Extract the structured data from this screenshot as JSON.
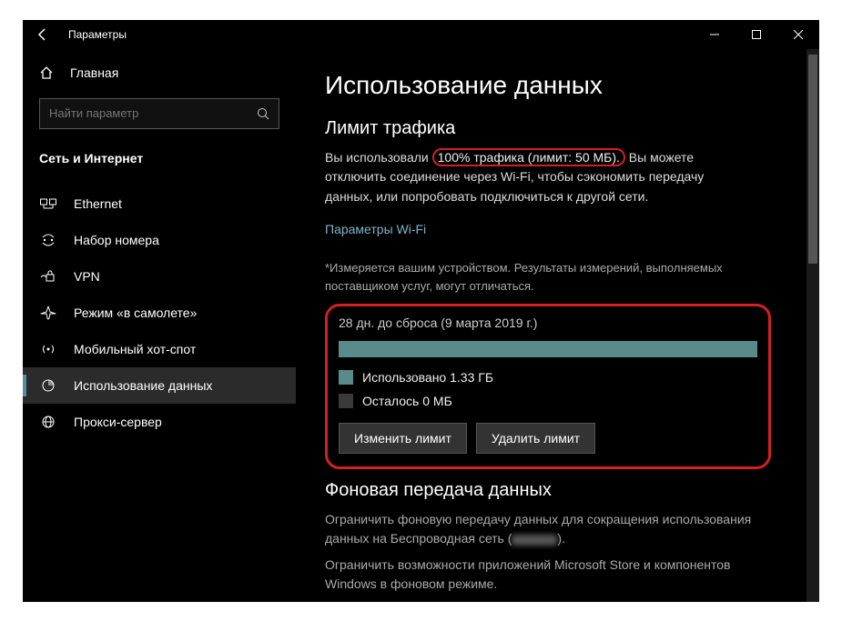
{
  "titlebar": {
    "title": "Параметры"
  },
  "sidebar": {
    "home": "Главная",
    "search_placeholder": "Найти параметр",
    "category": "Сеть и Интернет",
    "items": [
      {
        "icon": "ethernet-icon",
        "label": "Ethernet"
      },
      {
        "icon": "dialup-icon",
        "label": "Набор номера"
      },
      {
        "icon": "vpn-icon",
        "label": "VPN"
      },
      {
        "icon": "airplane-icon",
        "label": "Режим «в самолете»"
      },
      {
        "icon": "hotspot-icon",
        "label": "Мобильный хот-спот"
      },
      {
        "icon": "datausage-icon",
        "label": "Использование данных"
      },
      {
        "icon": "proxy-icon",
        "label": "Прокси-сервер"
      }
    ]
  },
  "main": {
    "heading": "Использование данных",
    "limit_heading": "Лимит трафика",
    "usage_prefix": "Вы использовали ",
    "usage_highlight": "100% трафика (лимит: 50 МБ).",
    "usage_suffix": " Вы можете отключить соединение через Wi-Fi, чтобы сэкономить передачу данных, или попробовать подключиться к другой сети.",
    "wifi_link": "Параметры Wi-Fi",
    "note": "*Измеряется вашим устройством. Результаты измерений, выполняемых поставщиком услуг, могут отличаться.",
    "reset_line": "28 дн. до сброса (9 марта 2019 г.)",
    "used_label": "Использовано 1.33 ГБ",
    "left_label": "Осталось 0 МБ",
    "btn_change": "Изменить лимит",
    "btn_delete": "Удалить лимит",
    "bg_heading": "Фоновая передача данных",
    "bg_p1_a": "Ограничить фоновую передачу данных для сокращения использования данных на Беспроводная сеть (",
    "bg_p1_b": ").",
    "bg_p2": "Ограничить возможности приложений Microsoft Store и компонентов Windows в фоновом режиме."
  },
  "colors": {
    "accent": "#5a8ba0",
    "annot": "#d61f1f",
    "progress": "#5a8b8b"
  }
}
